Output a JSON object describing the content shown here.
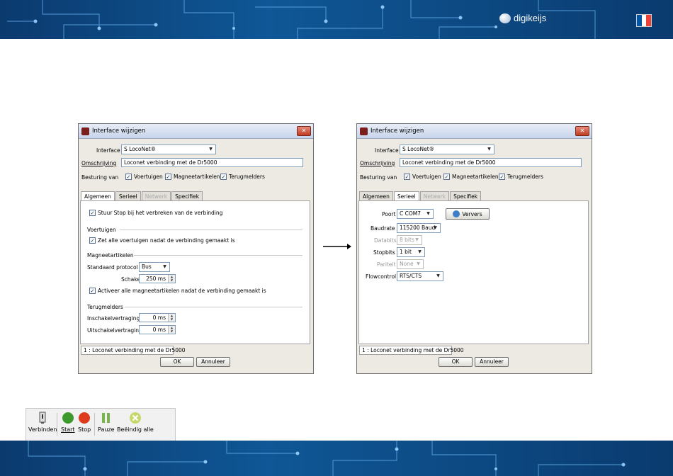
{
  "branding": {
    "name": "digikeijs"
  },
  "flag_colors": [
    "#0055a4",
    "#ffffff",
    "#ef4135"
  ],
  "dialogs": [
    {
      "title": "Interface wijzigen",
      "close_label": "✕",
      "interface_label": "Interface",
      "interface_value": "S  LocoNet®",
      "omschrijving_label": "Omschrijving",
      "omschrijving_value": "Loconet verbinding met de Dr5000",
      "besturing_label": "Besturing van",
      "checks": [
        "Voertuigen",
        "Magneetartikelen",
        "Terugmelders"
      ],
      "tabs": [
        "Algemeen",
        "Serieel",
        "Netwerk",
        "Specifiek"
      ],
      "active_tab": "Algemeen",
      "status_item": "1 : Loconet verbinding met de Dr5000",
      "ok_label": "OK",
      "cancel_label": "Annuleer"
    },
    {
      "title": "Interface wijzigen",
      "close_label": "✕",
      "interface_label": "Interface",
      "interface_value": "S  LocoNet®",
      "omschrijving_label": "Omschrijving",
      "omschrijving_value": "Loconet verbinding met de Dr5000",
      "besturing_label": "Besturing van",
      "checks": [
        "Voertuigen",
        "Magneetartikelen",
        "Terugmelders"
      ],
      "tabs": [
        "Algemeen",
        "Serieel",
        "Netwerk",
        "Specifiek"
      ],
      "active_tab": "Serieel",
      "status_item": "1 : Loconet verbinding met de Dr5000",
      "ok_label": "OK",
      "cancel_label": "Annuleer"
    }
  ],
  "algemeen": {
    "stop_check": "Stuur Stop bij het verbreken van de verbinding",
    "voertuigen_header": "Voertuigen",
    "voertuigen_check": "Zet alle voertuigen nadat de verbinding gemaakt is",
    "magneet_header": "Magneetartikelen",
    "protocol_label": "Standaard protocol",
    "protocol_value": "Bus",
    "schakeltijd_label": "Schakeltijd",
    "schakeltijd_value": "250 ms",
    "activeer_check": "Activeer alle magneetartikelen nadat de verbinding gemaakt is",
    "terugmelders_header": "Terugmelders",
    "inschakel_label": "Inschakelvertraging",
    "inschakel_value": "0 ms",
    "uitschakel_label": "Uitschakelvertraging",
    "uitschakel_value": "0 ms"
  },
  "serieel": {
    "poort_label": "Poort",
    "poort_value": "C  COM7",
    "ververs_label": "Ververs",
    "baudrate_label": "Baudrate",
    "baudrate_value": "115200 Baud",
    "databits_label": "Databits",
    "databits_value": "8 bits",
    "stopbits_label": "Stopbits",
    "stopbits_value": "1 bit",
    "pariteit_label": "Pariteit",
    "pariteit_value": "None",
    "flowcontrol_label": "Flowcontrol",
    "flowcontrol_value": "RTS/CTS"
  },
  "toolbar": {
    "verbinden": "Verbinden",
    "start": "Start",
    "stop": "Stop",
    "pauze": "Pauze",
    "beeindig": "Beëindig alle"
  }
}
